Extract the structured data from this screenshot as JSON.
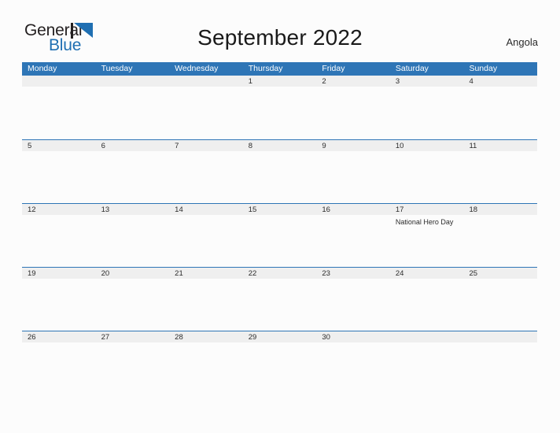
{
  "brand": {
    "name_part1": "General",
    "name_part2": "Blue",
    "mark": "triangle-logo"
  },
  "header": {
    "title": "September 2022",
    "region": "Angola"
  },
  "colors": {
    "header_blue": "#2e75b6",
    "row_line_blue": "#2e75b6",
    "date_band_gray": "#efefef",
    "brand_blue": "#1f6fb2",
    "page_background": "#fcfcfc"
  },
  "calendar": {
    "weekdays": [
      "Monday",
      "Tuesday",
      "Wednesday",
      "Thursday",
      "Friday",
      "Saturday",
      "Sunday"
    ],
    "weeks": [
      [
        {
          "date": "",
          "events": []
        },
        {
          "date": "",
          "events": []
        },
        {
          "date": "",
          "events": []
        },
        {
          "date": "1",
          "events": []
        },
        {
          "date": "2",
          "events": []
        },
        {
          "date": "3",
          "events": []
        },
        {
          "date": "4",
          "events": []
        }
      ],
      [
        {
          "date": "5",
          "events": []
        },
        {
          "date": "6",
          "events": []
        },
        {
          "date": "7",
          "events": []
        },
        {
          "date": "8",
          "events": []
        },
        {
          "date": "9",
          "events": []
        },
        {
          "date": "10",
          "events": []
        },
        {
          "date": "11",
          "events": []
        }
      ],
      [
        {
          "date": "12",
          "events": []
        },
        {
          "date": "13",
          "events": []
        },
        {
          "date": "14",
          "events": []
        },
        {
          "date": "15",
          "events": []
        },
        {
          "date": "16",
          "events": []
        },
        {
          "date": "17",
          "events": [
            "National Hero Day"
          ]
        },
        {
          "date": "18",
          "events": []
        }
      ],
      [
        {
          "date": "19",
          "events": []
        },
        {
          "date": "20",
          "events": []
        },
        {
          "date": "21",
          "events": []
        },
        {
          "date": "22",
          "events": []
        },
        {
          "date": "23",
          "events": []
        },
        {
          "date": "24",
          "events": []
        },
        {
          "date": "25",
          "events": []
        }
      ],
      [
        {
          "date": "26",
          "events": []
        },
        {
          "date": "27",
          "events": []
        },
        {
          "date": "28",
          "events": []
        },
        {
          "date": "29",
          "events": []
        },
        {
          "date": "30",
          "events": []
        },
        {
          "date": "",
          "events": []
        },
        {
          "date": "",
          "events": []
        }
      ]
    ]
  }
}
